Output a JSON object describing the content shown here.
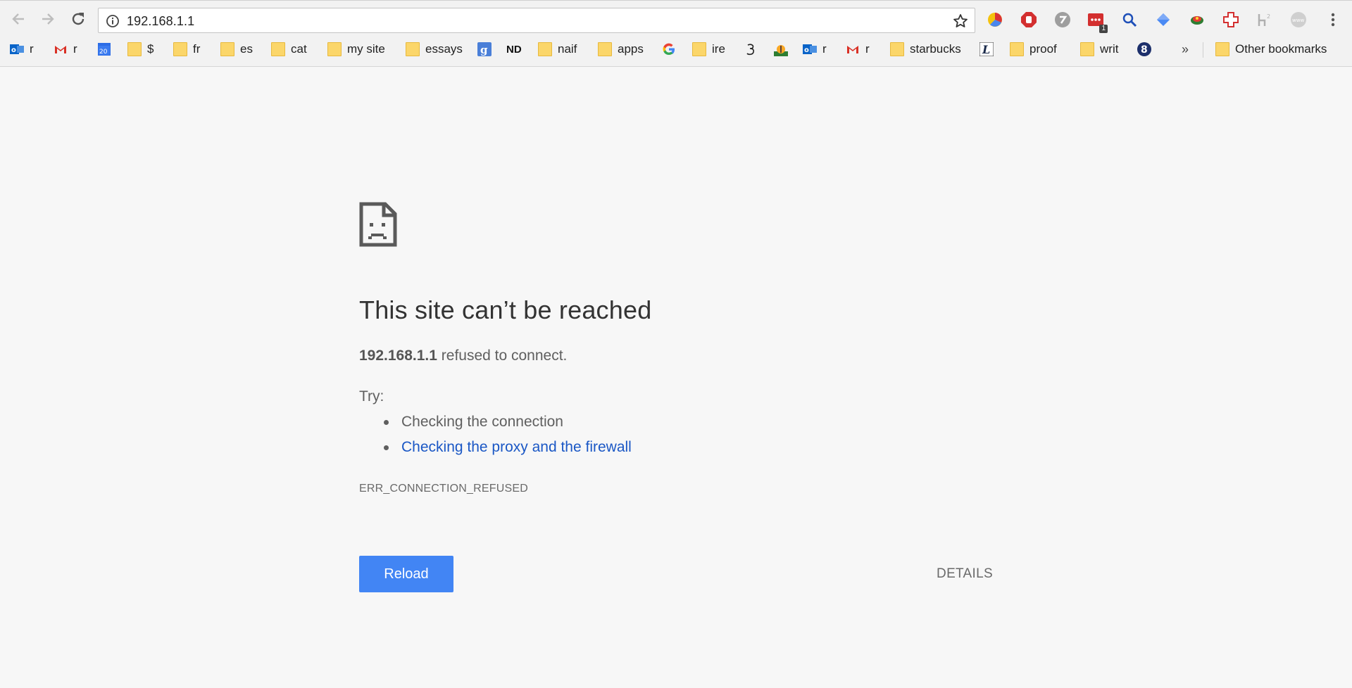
{
  "toolbar": {
    "url": "192.168.1.1",
    "extension_badge": "1"
  },
  "bookmarks": {
    "items": [
      {
        "label": "r",
        "icon": "outlook-icon"
      },
      {
        "label": "r",
        "icon": "gmail-icon"
      },
      {
        "label": "20",
        "icon": "calendar-icon"
      },
      {
        "label": "$",
        "icon": "folder-icon"
      },
      {
        "label": "fr",
        "icon": "folder-icon"
      },
      {
        "label": "es",
        "icon": "folder-icon"
      },
      {
        "label": "cat",
        "icon": "folder-icon"
      },
      {
        "label": "my site",
        "icon": "folder-icon"
      },
      {
        "label": "essays",
        "icon": "folder-icon"
      },
      {
        "label": "",
        "icon": "google-scholar-icon"
      },
      {
        "label": "ND",
        "icon": "nd-icon"
      },
      {
        "label": "naif",
        "icon": "folder-icon"
      },
      {
        "label": "apps",
        "icon": "folder-icon"
      },
      {
        "label": "",
        "icon": "google-icon"
      },
      {
        "label": "ire",
        "icon": "folder-icon"
      },
      {
        "label": "",
        "icon": "three-icon"
      },
      {
        "label": "",
        "icon": "palm-icon"
      },
      {
        "label": "r",
        "icon": "outlook-icon"
      },
      {
        "label": "r",
        "icon": "gmail-icon"
      },
      {
        "label": "starbucks",
        "icon": "folder-icon"
      },
      {
        "label": "",
        "icon": "l-icon"
      },
      {
        "label": "proof",
        "icon": "folder-icon"
      },
      {
        "label": "writ",
        "icon": "folder-icon"
      },
      {
        "label": "8",
        "icon": "eight-icon"
      }
    ],
    "overflow": "»",
    "other": "Other bookmarks"
  },
  "error": {
    "title": "This site can’t be reached",
    "host": "192.168.1.1",
    "message": " refused to connect.",
    "try_label": "Try:",
    "suggestions": [
      "Checking the connection",
      "Checking the proxy and the firewall"
    ],
    "code": "ERR_CONNECTION_REFUSED",
    "reload": "Reload",
    "details": "DETAILS"
  },
  "colors": {
    "accent": "#4285f4",
    "link": "#1a57c5",
    "page_bg": "#f7f7f7"
  }
}
